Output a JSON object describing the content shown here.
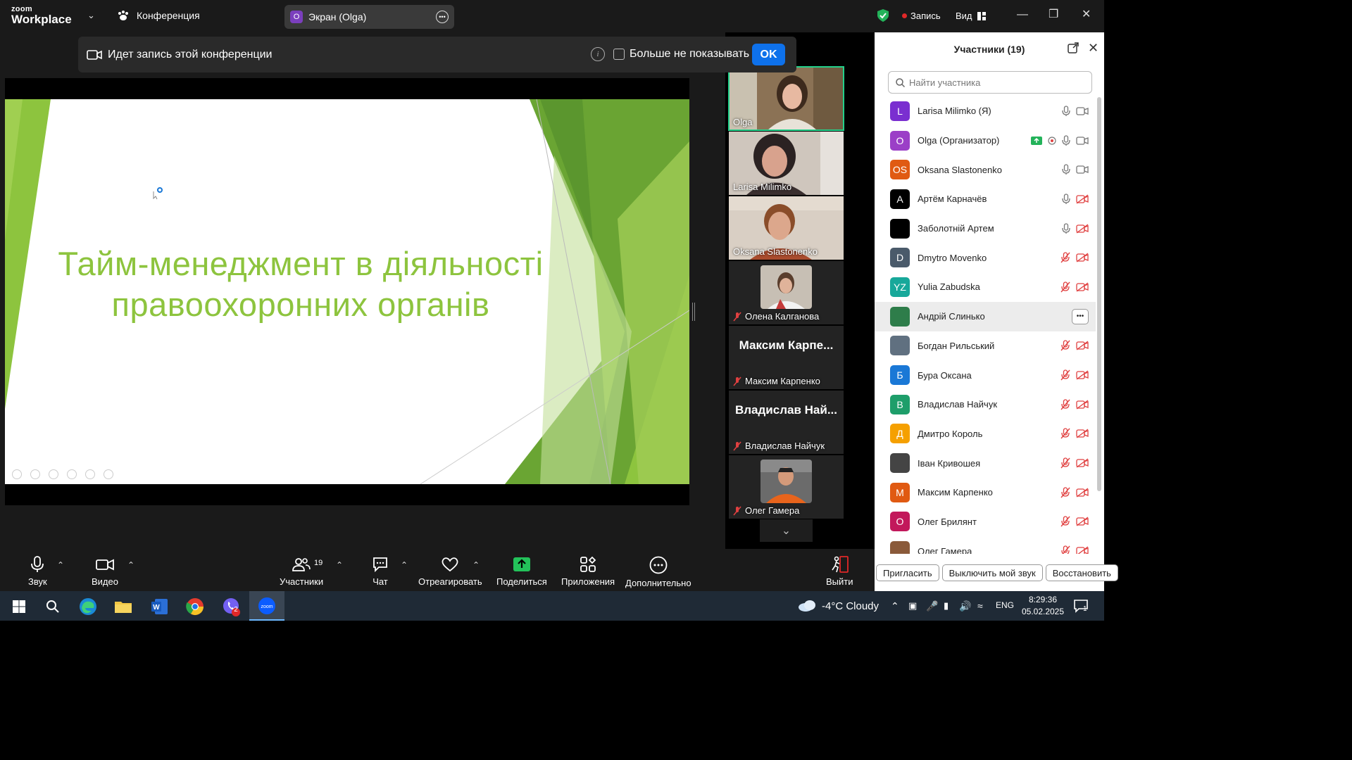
{
  "topbar": {
    "logo_top": "zoom",
    "logo_bottom": "Workplace",
    "conference_label": "Конференция",
    "screen_badge": "O",
    "screen_label": "Экран (Olga)",
    "record_label": "Запись",
    "view_label": "Вид"
  },
  "banner": {
    "text": "Идет запись этой конференции",
    "dont_show": "Больше не показывать",
    "ok": "OK"
  },
  "slide": {
    "title_line1": "Тайм-менеджмент в діяльності",
    "title_line2": "правоохоронних органів",
    "title_color": "#8dc43e"
  },
  "video_tiles": [
    {
      "name": "Olga",
      "muted": false,
      "type": "video"
    },
    {
      "name": "Larisa Milimko",
      "muted": false,
      "type": "video"
    },
    {
      "name": "Oksana Slastonenko",
      "muted": false,
      "type": "video"
    },
    {
      "name": "Олена Калганова",
      "muted": true,
      "type": "avatar"
    },
    {
      "name": "Максим Карпенко",
      "display": "Максим Карпе...",
      "muted": true,
      "type": "name"
    },
    {
      "name": "Владислав Найчук",
      "display": "Владислав Най...",
      "muted": true,
      "type": "name"
    },
    {
      "name": "Олег Гамера",
      "muted": true,
      "type": "avatar"
    }
  ],
  "participants": {
    "title": "Участники (19)",
    "search_placeholder": "Найти участника",
    "list": [
      {
        "initials": "L",
        "color": "#7a2fd0",
        "name": "Larisa Milimko (Я)",
        "mic": "on",
        "cam": "on"
      },
      {
        "initials": "O",
        "color": "#9b3fc7",
        "name": "Olga (Организатор)",
        "mic": "on",
        "cam": "on",
        "sharing": true
      },
      {
        "initials": "OS",
        "color": "#e05a12",
        "name": "Oksana Slastonenko",
        "mic": "on",
        "cam": "on"
      },
      {
        "initials": "A",
        "color": "#000000",
        "name": "Артём Карначёв",
        "mic": "on",
        "cam": "off"
      },
      {
        "initials": "",
        "color": "#000000",
        "name": "Заболотній Артем",
        "mic": "on",
        "cam": "off"
      },
      {
        "initials": "D",
        "color": "#4a5a6a",
        "name": "Dmytro Movenko",
        "mic": "off",
        "cam": "off"
      },
      {
        "initials": "YZ",
        "color": "#17a89a",
        "name": "Yulia Zabudska",
        "mic": "off",
        "cam": "off"
      },
      {
        "initials": "",
        "color": "#2e7d4a",
        "name": "Андрій Слинько",
        "mic": "",
        "cam": "",
        "highlight": true
      },
      {
        "initials": "",
        "color": "#607080",
        "name": "Богдан Рильський",
        "mic": "off",
        "cam": "off"
      },
      {
        "initials": "Б",
        "color": "#1a78d6",
        "name": "Бура Оксана",
        "mic": "off",
        "cam": "off"
      },
      {
        "initials": "В",
        "color": "#1e9e6a",
        "name": "Владислав Найчук",
        "mic": "off",
        "cam": "off"
      },
      {
        "initials": "Д",
        "color": "#f5a000",
        "name": "Дмитро Король",
        "mic": "off",
        "cam": "off"
      },
      {
        "initials": "",
        "color": "#444444",
        "name": "Іван Кривошея",
        "mic": "off",
        "cam": "off"
      },
      {
        "initials": "М",
        "color": "#e05a12",
        "name": "Максим Карпенко",
        "mic": "off",
        "cam": "off"
      },
      {
        "initials": "О",
        "color": "#c2185b",
        "name": "Олег Брилянт",
        "mic": "off",
        "cam": "off"
      },
      {
        "initials": "",
        "color": "#8a5a3a",
        "name": "Олег Гамера",
        "mic": "off",
        "cam": "off"
      }
    ],
    "footer": {
      "invite": "Пригласить",
      "mute_me": "Выключить мой звук",
      "restore": "Восстановить"
    }
  },
  "toolbar": {
    "audio": "Звук",
    "video": "Видео",
    "participants": "Участники",
    "participants_count": "19",
    "chat": "Чат",
    "react": "Отреагировать",
    "share": "Поделиться",
    "apps": "Приложения",
    "more": "Дополнительно",
    "leave": "Выйти"
  },
  "taskbar": {
    "weather": "-4°C  Cloudy",
    "lang": "ENG",
    "time": "8:29:36",
    "date": "05.02.2025",
    "viber_badge": "2",
    "notif_badge": "1"
  }
}
